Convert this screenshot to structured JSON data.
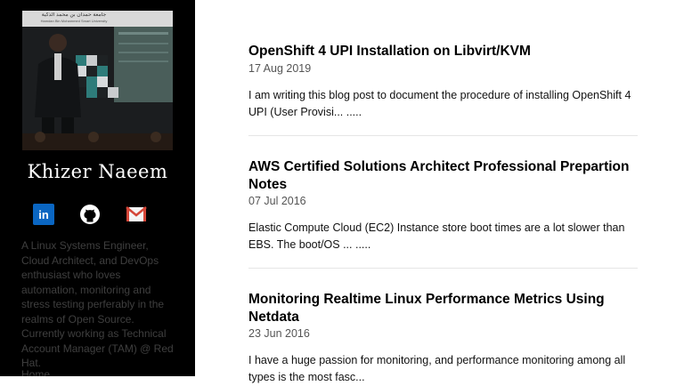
{
  "site": {
    "author_name": "Khizer Naeem",
    "avatar_banner_text": "جامعة حمدان بن محمد الذكية",
    "avatar_banner_subtext": "Hamdan Bin Mohammed Smart University"
  },
  "social": [
    {
      "name": "linkedin",
      "label": "in",
      "color": "#0a66c2"
    },
    {
      "name": "github",
      "color": "#ffffff"
    },
    {
      "name": "gmail",
      "color": "#d44638"
    }
  ],
  "bio": {
    "line1": "A Linux Systems Engineer, Cloud Architect, and DevOps enthusiast who loves automation, monitoring and stress testing perferably in the realms of Open Source.",
    "line2": "Currently working as Technical Account Manager (TAM) @ Red Hat."
  },
  "nav": {
    "home": "Home"
  },
  "posts": [
    {
      "title": "OpenShift 4 UPI Installation on Libvirt/KVM",
      "date": "17 Aug 2019",
      "excerpt": "I am writing this blog post to document the procedure of installing OpenShift 4 UPI (User Provisi... ....."
    },
    {
      "title": "AWS Certified Solutions Architect Professional Prepartion Notes",
      "date": "07 Jul 2016",
      "excerpt": "Elastic Compute Cloud (EC2) Instance store boot times are a lot slower than EBS. The boot/OS ... ....."
    },
    {
      "title": "Monitoring Realtime Linux Performance Metrics Using Netdata",
      "date": "23 Jun 2016",
      "excerpt": "I have a huge passion for monitoring, and performance monitoring among all types is the most fasc..."
    }
  ]
}
